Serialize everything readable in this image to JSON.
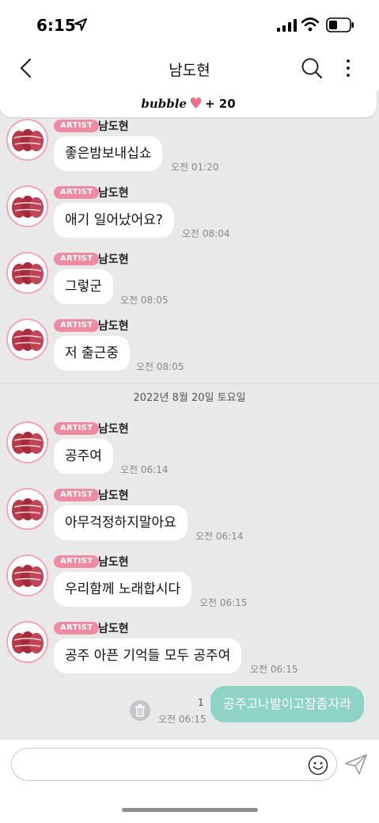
{
  "status_bar": {
    "time": "6:15"
  },
  "header": {
    "title": "남도현"
  },
  "bubble_bar": {
    "brand": "bubble",
    "count": "+ 20"
  },
  "messages": [
    {
      "badge": "ARTIST",
      "sender": "남도현",
      "text": "좋은밤보내십쇼",
      "time": "오전 01:20"
    },
    {
      "badge": "ARTIST",
      "sender": "남도현",
      "text": "애기 일어났어요?",
      "time": "오전 08:04"
    },
    {
      "badge": "ARTIST",
      "sender": "남도현",
      "text": "그렇군",
      "time": "오전 08:05"
    },
    {
      "badge": "ARTIST",
      "sender": "남도현",
      "text": "저 출근중",
      "time": "오전 08:05"
    },
    {
      "badge": "ARTIST",
      "sender": "남도현",
      "text": "공주여",
      "time": "오전 06:14"
    },
    {
      "badge": "ARTIST",
      "sender": "남도현",
      "text": "아무걱정하지말아요",
      "time": "오전 06:14"
    },
    {
      "badge": "ARTIST",
      "sender": "남도현",
      "text": "우리함께 노래합시다",
      "time": "오전 06:15"
    },
    {
      "badge": "ARTIST",
      "sender": "남도현",
      "text": "공주 아픈 기억들 모두 공주여",
      "time": "오전 06:15"
    }
  ],
  "date_separator": "2022년 8월 20일 토요일",
  "my_message": {
    "text": "공주고나발이고잠좀자라",
    "unread": "1",
    "time": "오전 06:15"
  },
  "input": {
    "placeholder": ""
  },
  "colors": {
    "badge": "#ef8aa3",
    "my_bubble": "#8fd3c6",
    "heart": "#f06b8b",
    "chat_bg": "#e9e9ea"
  },
  "icons": [
    "location-arrow-icon",
    "signal-icon",
    "wifi-icon",
    "battery-icon",
    "back-chevron-icon",
    "search-icon",
    "more-vertical-icon",
    "heart-icon",
    "trash-icon",
    "emoji-icon",
    "send-icon"
  ]
}
